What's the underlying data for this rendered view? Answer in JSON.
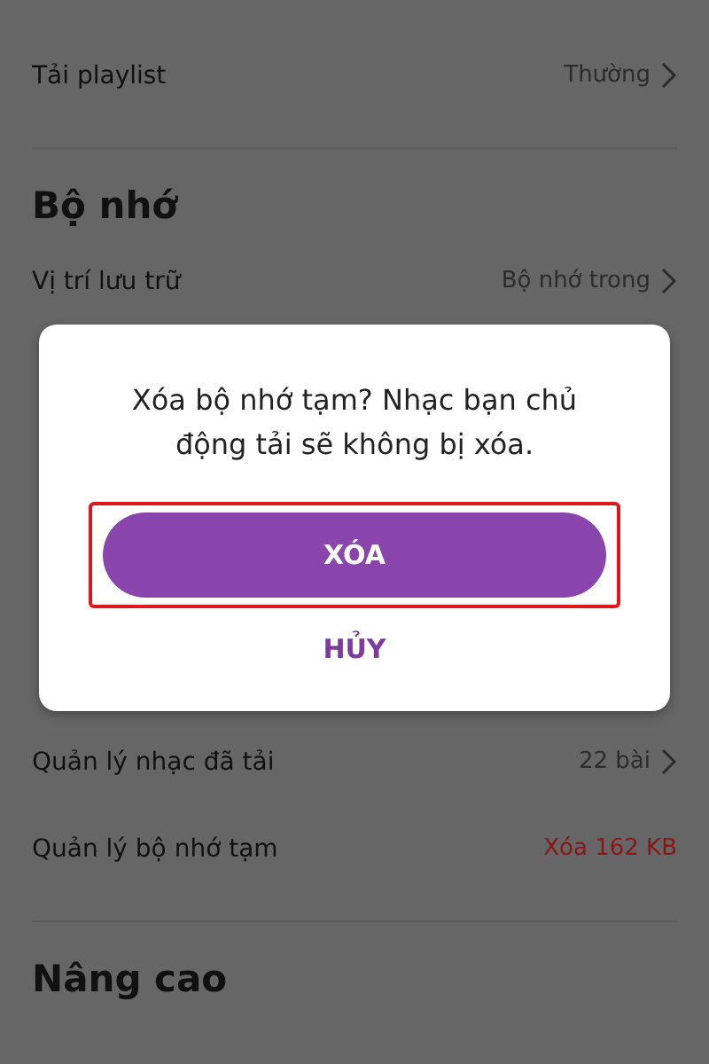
{
  "sections": [
    {
      "rows": [
        {
          "label": "Tải playlist",
          "value": "Thường",
          "kind": "nav",
          "chevron": true
        }
      ]
    },
    {
      "heading": "Bộ nhớ",
      "rows": [
        {
          "label": "Vị trí lưu trữ",
          "value": "Bộ nhớ trong",
          "kind": "nav",
          "chevron": true
        },
        {
          "label": "Quản lý nhạc đã tải",
          "value": "22 bài",
          "kind": "nav",
          "chevron": true
        },
        {
          "label": "Quản lý bộ nhớ tạm",
          "value": "Xóa 162 KB",
          "kind": "action",
          "chevron": false
        }
      ]
    },
    {
      "heading": "Nâng cao"
    }
  ],
  "dialog": {
    "message": "Xóa bộ nhớ tạm? Nhạc bạn chủ động tải sẽ không bị xóa.",
    "buttons": [
      {
        "label": "XÓA",
        "kind": "primary",
        "highlighted": true
      },
      {
        "label": "HỦY",
        "kind": "text",
        "highlighted": false
      }
    ]
  }
}
